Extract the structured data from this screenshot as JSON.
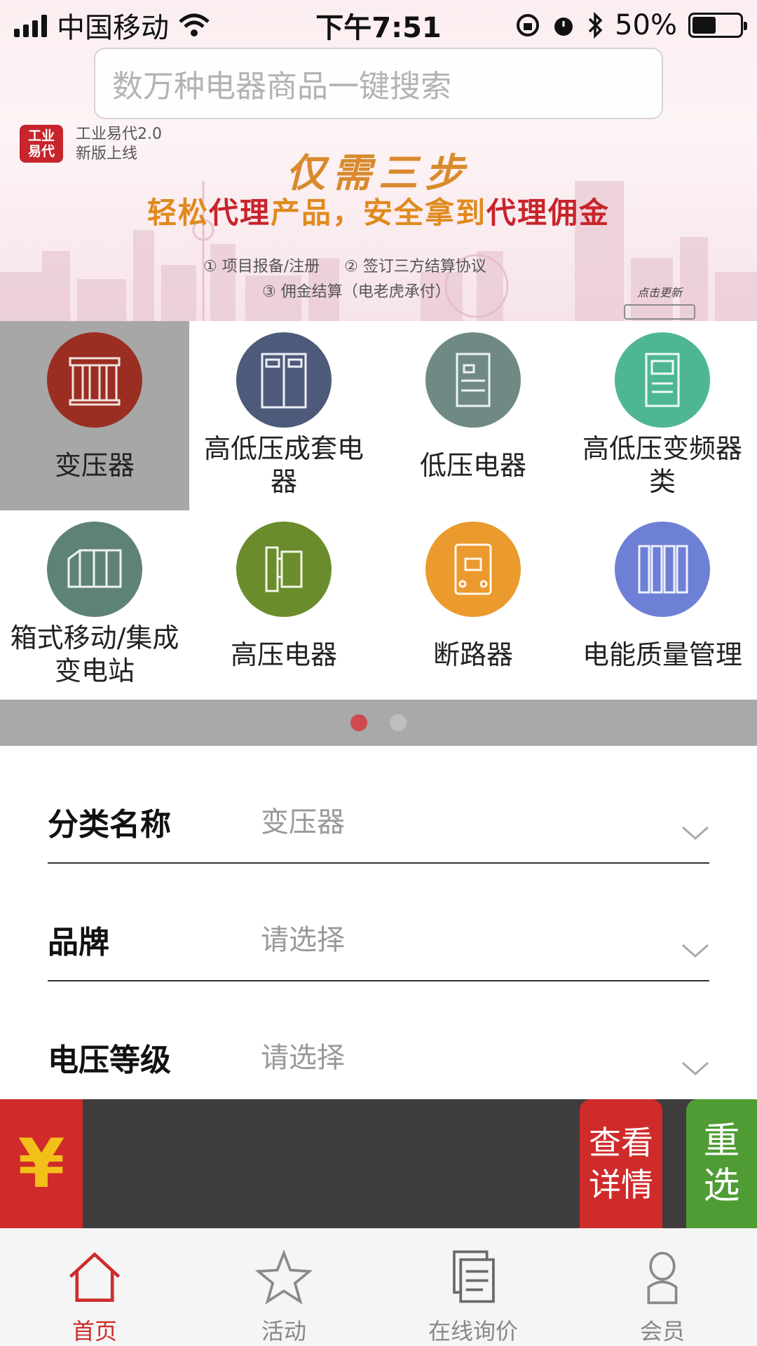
{
  "status_bar": {
    "carrier": "中国移动",
    "time": "下午7:51",
    "battery": "50%",
    "battery_level": 0.5
  },
  "search": {
    "placeholder": "数万种电器商品一键搜索"
  },
  "banner": {
    "logo_text": "工业易代",
    "brand_line1": "工业易代2.0",
    "brand_line2": "新版上线",
    "title": "仅需三步",
    "subtitle_parts": [
      "轻松",
      "代理",
      "产品，安全拿到",
      "代理",
      "佣金"
    ],
    "step1": "① 项目报备/注册",
    "step2": "② 签订三方结算协议",
    "step3": "③ 佣金结算（电老虎承付）",
    "refresh_label": "点击更新"
  },
  "categories": [
    {
      "label": "变压器",
      "color": "#9a2e22",
      "icon": "transformer-icon",
      "selected": true
    },
    {
      "label": "高低压成套电器",
      "color": "#4d5a7a",
      "icon": "switchgear-cabinet-icon",
      "selected": false
    },
    {
      "label": "低压电器",
      "color": "#6f8a84",
      "icon": "soft-starter-icon",
      "selected": false
    },
    {
      "label": "高低压变频器类",
      "color": "#4fb694",
      "icon": "inverter-icon",
      "selected": false
    },
    {
      "label": "箱式移动/集成变电站",
      "color": "#5f8277",
      "icon": "substation-box-icon",
      "selected": false
    },
    {
      "label": "高压电器",
      "color": "#6a8c2c",
      "icon": "vacuum-breaker-icon",
      "selected": false
    },
    {
      "label": "断路器",
      "color": "#eb9a2d",
      "icon": "circuit-breaker-icon",
      "selected": false
    },
    {
      "label": "电能质量管理",
      "color": "#6e7fd6",
      "icon": "power-quality-cabinet-icon",
      "selected": false
    }
  ],
  "pager": {
    "pages": 2,
    "active": 1
  },
  "form": [
    {
      "label": "分类名称",
      "value": "变压器"
    },
    {
      "label": "品牌",
      "value": "请选择"
    },
    {
      "label": "电压等级",
      "value": "请选择"
    }
  ],
  "actions": {
    "currency_symbol": "¥",
    "detail_label": "查看详情",
    "reset_label": "重选"
  },
  "tabbar": [
    {
      "label": "首页",
      "icon": "home-icon",
      "active": true
    },
    {
      "label": "活动",
      "icon": "star-icon",
      "active": false
    },
    {
      "label": "在线询价",
      "icon": "document-icon",
      "active": false
    },
    {
      "label": "会员",
      "icon": "user-icon",
      "active": false
    }
  ],
  "colors": {
    "brand_red": "#cf2b2b",
    "brand_green": "#4f9c34",
    "accent_orange": "#e08a1e",
    "yen_gold": "#f2c018"
  }
}
